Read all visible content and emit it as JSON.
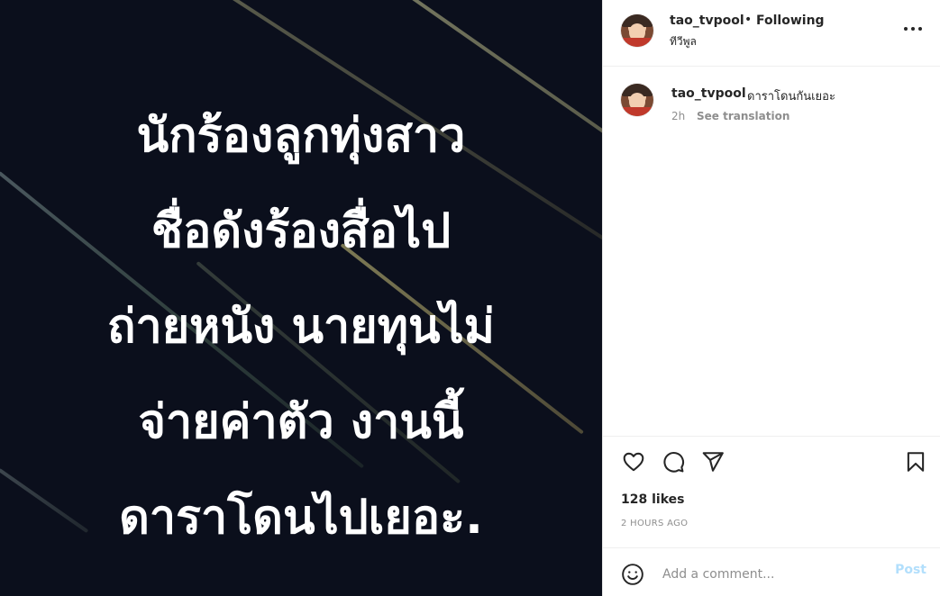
{
  "post": {
    "image_text_lines": [
      "นักร้องลูกทุ่งสาว",
      "ชื่อดังร้องสื่อไป",
      "ถ่ายหนัง นายทุนไม่",
      "จ่ายค่าตัว งานนี้",
      "ดาราโดนไปเยอะ."
    ]
  },
  "header": {
    "username": "tao_tvpool",
    "separator": "•",
    "follow_status": "Following",
    "location": "ทีวีพูล",
    "more_icon": "more-horizontal-icon"
  },
  "caption": {
    "username": "tao_tvpool",
    "text": "ดาราโดนกันเยอะ",
    "time": "2h",
    "translate_label": "See translation"
  },
  "actions": {
    "icons": [
      "heart-icon",
      "comment-icon",
      "share-icon",
      "bookmark-icon"
    ],
    "likes": "128 likes",
    "time_ago": "2 HOURS AGO"
  },
  "comment_box": {
    "placeholder": "Add a comment...",
    "post_label": "Post",
    "emoji_icon": "emoji-icon"
  },
  "colors": {
    "image_background": "#0b0f1c",
    "text_primary": "#262626",
    "text_secondary": "#8e8e8e",
    "post_disabled": "#b2dffc"
  }
}
